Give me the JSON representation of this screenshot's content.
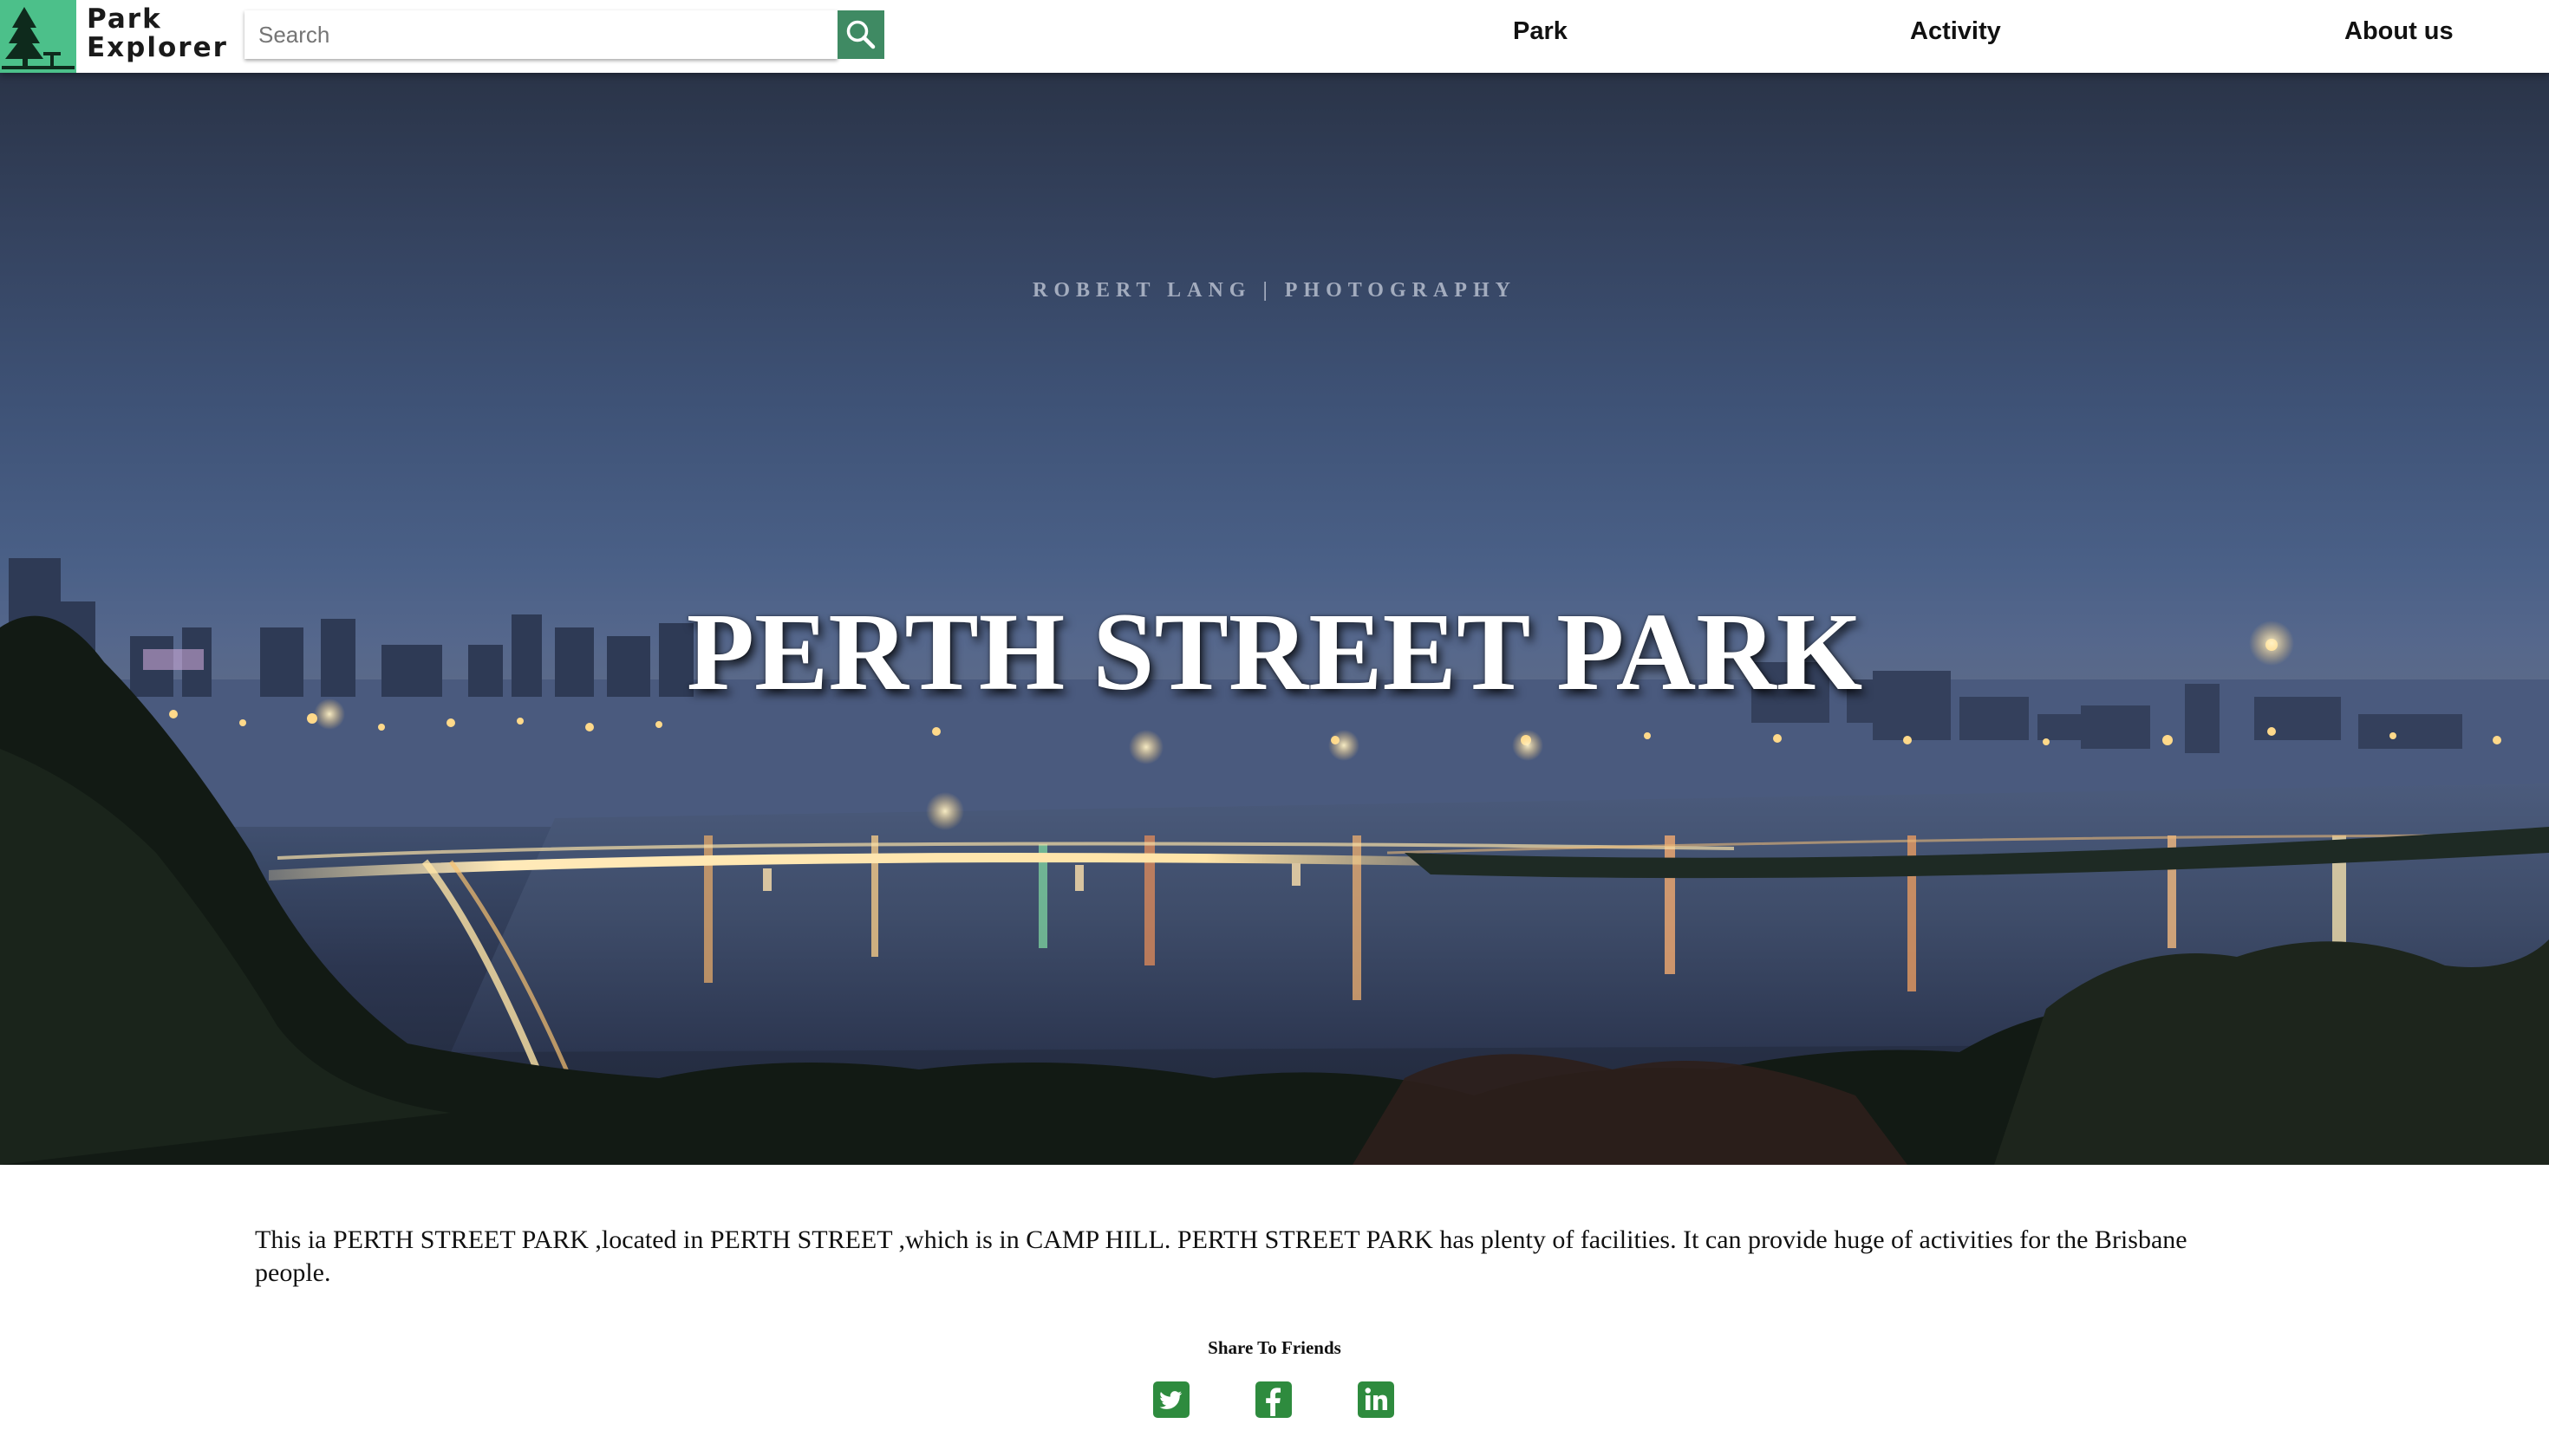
{
  "header": {
    "logo": {
      "line1": "Park",
      "line2": "Explorer",
      "icon": "pine-tree-icon"
    },
    "search": {
      "placeholder": "Search",
      "value": "",
      "button_icon": "search-icon"
    },
    "nav": [
      {
        "label": "Park"
      },
      {
        "label": "Activity"
      },
      {
        "label": "About us"
      }
    ]
  },
  "hero": {
    "watermark": "ROBERT LANG | PHOTOGRAPHY",
    "title": "PERTH STREET PARK",
    "image_description": "night cityscape over river with illuminated bridge"
  },
  "content": {
    "description": "This ia PERTH STREET PARK ,located in PERTH STREET ,which is in CAMP HILL. PERTH STREET PARK has plenty of facilities. It can provide huge of activities for the Brisbane people."
  },
  "share": {
    "title": "Share To Friends",
    "icons": [
      "twitter-icon",
      "facebook-icon",
      "linkedin-icon"
    ]
  },
  "colors": {
    "brand_green": "#4cc08a",
    "search_button": "#3f8a63",
    "share_icon_green": "#2e8b3e"
  }
}
